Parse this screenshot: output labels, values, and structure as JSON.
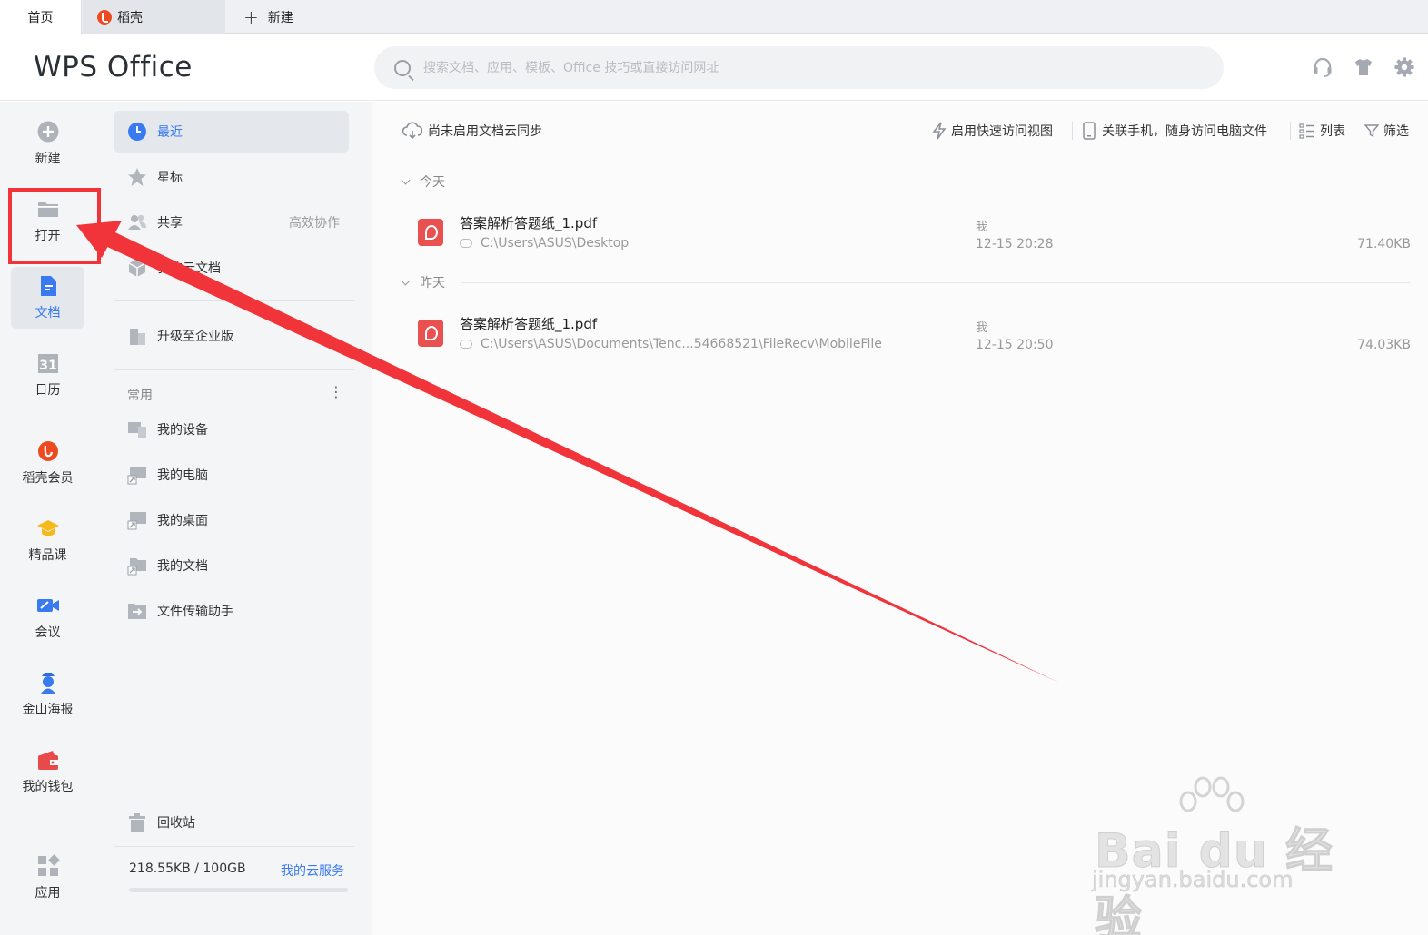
{
  "tabs": [
    {
      "label": "首页"
    },
    {
      "label": "稻壳"
    },
    {
      "label": "新建"
    }
  ],
  "header": {
    "logo": "WPS Office",
    "search_placeholder": "搜索文档、应用、模板、Office 技巧或直接访问网址",
    "icons": [
      "headset-icon",
      "skin-icon",
      "settings-icon"
    ]
  },
  "rail": {
    "items": [
      {
        "label": "新建",
        "icon": "plus-circle-icon"
      },
      {
        "label": "打开",
        "icon": "folder-icon"
      },
      {
        "label": "文档",
        "icon": "document-icon",
        "active": true
      },
      {
        "label": "日历",
        "icon": "calendar-icon"
      },
      {
        "label": "稻壳会员",
        "icon": "daoke-icon"
      },
      {
        "label": "精品课",
        "icon": "graduation-cap-icon"
      },
      {
        "label": "会议",
        "icon": "video-icon"
      },
      {
        "label": "金山海报",
        "icon": "poster-icon"
      },
      {
        "label": "我的钱包",
        "icon": "wallet-icon"
      },
      {
        "label": "应用",
        "icon": "apps-icon"
      }
    ],
    "calendar_day": "31"
  },
  "panel": {
    "nav": [
      {
        "label": "最近",
        "icon": "clock-icon",
        "active": true
      },
      {
        "label": "星标",
        "icon": "star-icon"
      },
      {
        "label": "共享",
        "icon": "people-icon",
        "extra": "高效协作"
      },
      {
        "label": "我的云文档",
        "icon": "cube-icon"
      }
    ],
    "upgrade": "升级至企业版",
    "common_title": "常用",
    "common": [
      {
        "label": "我的设备",
        "icon": "devices-icon"
      },
      {
        "label": "我的电脑",
        "icon": "computer-icon"
      },
      {
        "label": "我的桌面",
        "icon": "desktop-icon"
      },
      {
        "label": "我的文档",
        "icon": "folder-shortcut-icon"
      },
      {
        "label": "文件传输助手",
        "icon": "transfer-icon"
      }
    ],
    "recycle": "回收站",
    "storage": "218.55KB / 100GB",
    "cloud_service": "我的云服务",
    "storage_fraction": 2.17e-06
  },
  "main": {
    "sync_status": "尚未启用文档云同步",
    "quick_view": "启用快速访问视图",
    "link_phone": "关联手机，随身访问电脑文件",
    "list_view": "列表",
    "filter": "筛选",
    "groups": [
      {
        "label": "今天",
        "files": [
          {
            "name": "答案解析答题纸_1.pdf",
            "path": "C:\\Users\\ASUS\\Desktop",
            "owner": "我",
            "time": "12-15 20:28",
            "size": "71.40KB"
          }
        ]
      },
      {
        "label": "昨天",
        "files": [
          {
            "name": "答案解析答题纸_1.pdf",
            "path": "C:\\Users\\ASUS\\Documents\\Tenc...54668521\\FileRecv\\MobileFile",
            "owner": "我",
            "time": "12-15 20:50",
            "size": "74.03KB"
          }
        ]
      }
    ]
  },
  "annotation": {
    "color": "#f0343a"
  },
  "watermark": {
    "main": "Bai du 经验",
    "sub": "jingyan.baidu.com"
  },
  "colors": {
    "accent": "#3a7af0",
    "pdf": "#e8514f",
    "daoke": "#ee4a22"
  }
}
